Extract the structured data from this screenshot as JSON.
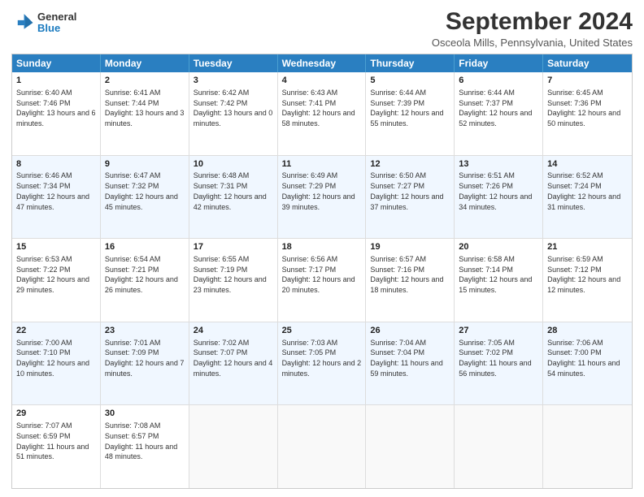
{
  "header": {
    "logo_line1": "General",
    "logo_line2": "Blue",
    "month_title": "September 2024",
    "subtitle": "Osceola Mills, Pennsylvania, United States"
  },
  "days_of_week": [
    "Sunday",
    "Monday",
    "Tuesday",
    "Wednesday",
    "Thursday",
    "Friday",
    "Saturday"
  ],
  "weeks": [
    [
      {
        "day": "1",
        "sunrise": "6:40 AM",
        "sunset": "7:46 PM",
        "daylight": "13 hours and 6 minutes."
      },
      {
        "day": "2",
        "sunrise": "6:41 AM",
        "sunset": "7:44 PM",
        "daylight": "13 hours and 3 minutes."
      },
      {
        "day": "3",
        "sunrise": "6:42 AM",
        "sunset": "7:42 PM",
        "daylight": "13 hours and 0 minutes."
      },
      {
        "day": "4",
        "sunrise": "6:43 AM",
        "sunset": "7:41 PM",
        "daylight": "12 hours and 58 minutes."
      },
      {
        "day": "5",
        "sunrise": "6:44 AM",
        "sunset": "7:39 PM",
        "daylight": "12 hours and 55 minutes."
      },
      {
        "day": "6",
        "sunrise": "6:44 AM",
        "sunset": "7:37 PM",
        "daylight": "12 hours and 52 minutes."
      },
      {
        "day": "7",
        "sunrise": "6:45 AM",
        "sunset": "7:36 PM",
        "daylight": "12 hours and 50 minutes."
      }
    ],
    [
      {
        "day": "8",
        "sunrise": "6:46 AM",
        "sunset": "7:34 PM",
        "daylight": "12 hours and 47 minutes."
      },
      {
        "day": "9",
        "sunrise": "6:47 AM",
        "sunset": "7:32 PM",
        "daylight": "12 hours and 45 minutes."
      },
      {
        "day": "10",
        "sunrise": "6:48 AM",
        "sunset": "7:31 PM",
        "daylight": "12 hours and 42 minutes."
      },
      {
        "day": "11",
        "sunrise": "6:49 AM",
        "sunset": "7:29 PM",
        "daylight": "12 hours and 39 minutes."
      },
      {
        "day": "12",
        "sunrise": "6:50 AM",
        "sunset": "7:27 PM",
        "daylight": "12 hours and 37 minutes."
      },
      {
        "day": "13",
        "sunrise": "6:51 AM",
        "sunset": "7:26 PM",
        "daylight": "12 hours and 34 minutes."
      },
      {
        "day": "14",
        "sunrise": "6:52 AM",
        "sunset": "7:24 PM",
        "daylight": "12 hours and 31 minutes."
      }
    ],
    [
      {
        "day": "15",
        "sunrise": "6:53 AM",
        "sunset": "7:22 PM",
        "daylight": "12 hours and 29 minutes."
      },
      {
        "day": "16",
        "sunrise": "6:54 AM",
        "sunset": "7:21 PM",
        "daylight": "12 hours and 26 minutes."
      },
      {
        "day": "17",
        "sunrise": "6:55 AM",
        "sunset": "7:19 PM",
        "daylight": "12 hours and 23 minutes."
      },
      {
        "day": "18",
        "sunrise": "6:56 AM",
        "sunset": "7:17 PM",
        "daylight": "12 hours and 20 minutes."
      },
      {
        "day": "19",
        "sunrise": "6:57 AM",
        "sunset": "7:16 PM",
        "daylight": "12 hours and 18 minutes."
      },
      {
        "day": "20",
        "sunrise": "6:58 AM",
        "sunset": "7:14 PM",
        "daylight": "12 hours and 15 minutes."
      },
      {
        "day": "21",
        "sunrise": "6:59 AM",
        "sunset": "7:12 PM",
        "daylight": "12 hours and 12 minutes."
      }
    ],
    [
      {
        "day": "22",
        "sunrise": "7:00 AM",
        "sunset": "7:10 PM",
        "daylight": "12 hours and 10 minutes."
      },
      {
        "day": "23",
        "sunrise": "7:01 AM",
        "sunset": "7:09 PM",
        "daylight": "12 hours and 7 minutes."
      },
      {
        "day": "24",
        "sunrise": "7:02 AM",
        "sunset": "7:07 PM",
        "daylight": "12 hours and 4 minutes."
      },
      {
        "day": "25",
        "sunrise": "7:03 AM",
        "sunset": "7:05 PM",
        "daylight": "12 hours and 2 minutes."
      },
      {
        "day": "26",
        "sunrise": "7:04 AM",
        "sunset": "7:04 PM",
        "daylight": "11 hours and 59 minutes."
      },
      {
        "day": "27",
        "sunrise": "7:05 AM",
        "sunset": "7:02 PM",
        "daylight": "11 hours and 56 minutes."
      },
      {
        "day": "28",
        "sunrise": "7:06 AM",
        "sunset": "7:00 PM",
        "daylight": "11 hours and 54 minutes."
      }
    ],
    [
      {
        "day": "29",
        "sunrise": "7:07 AM",
        "sunset": "6:59 PM",
        "daylight": "11 hours and 51 minutes."
      },
      {
        "day": "30",
        "sunrise": "7:08 AM",
        "sunset": "6:57 PM",
        "daylight": "11 hours and 48 minutes."
      },
      null,
      null,
      null,
      null,
      null
    ]
  ]
}
